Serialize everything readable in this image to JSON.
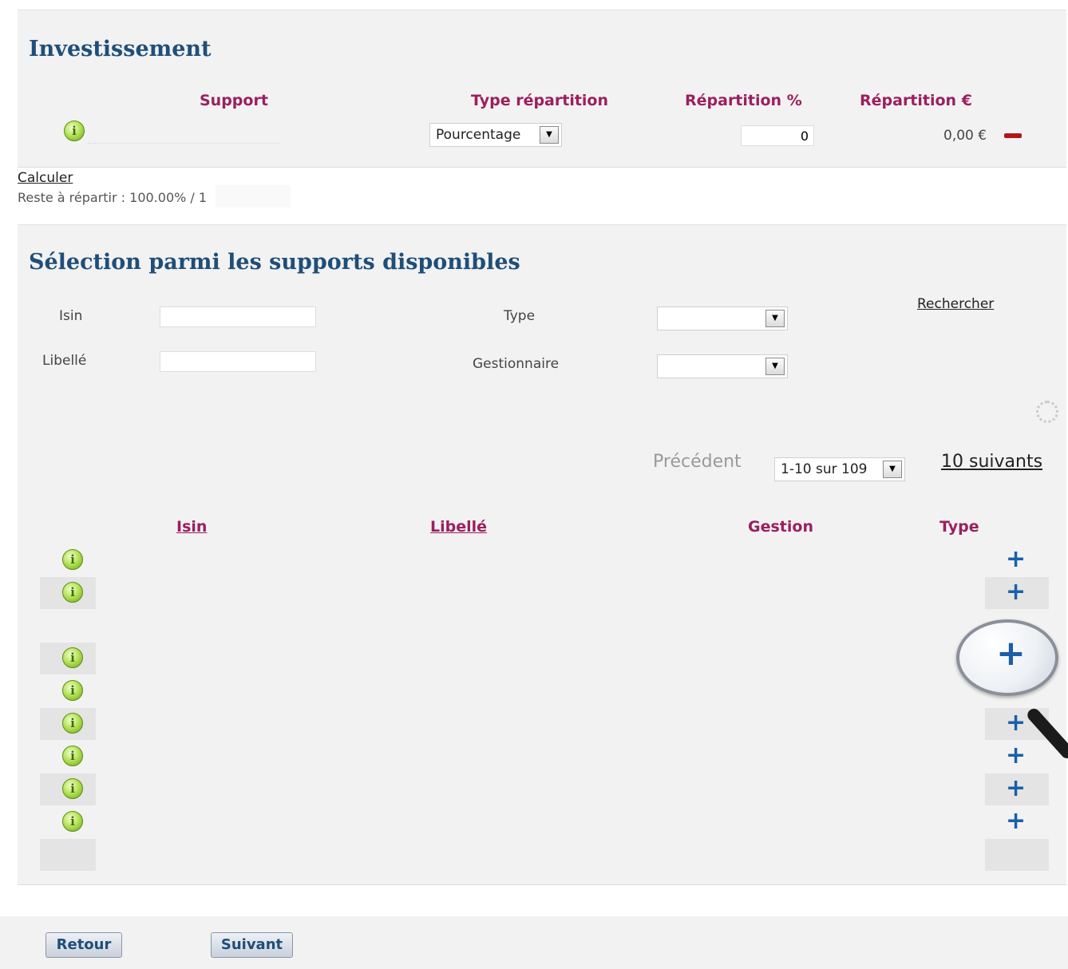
{
  "investissement": {
    "title": "Investissement",
    "headers": {
      "support": "Support",
      "type_repartition": "Type répartition",
      "repartition_pct": "Répartition %",
      "repartition_eur": "Répartition €"
    },
    "row": {
      "type_value": "Pourcentage",
      "pct_value": "0",
      "eur_value": "0,00 €"
    },
    "calculer_label": "Calculer",
    "reste_text": "Reste à répartir : 100.00% / 1"
  },
  "selection": {
    "title": "Sélection parmi les supports disponibles",
    "isin_label": "Isin",
    "libelle_label": "Libellé",
    "type_label": "Type",
    "gestionnaire_label": "Gestionnaire",
    "rechercher_label": "Rechercher",
    "precedent_label": "Précédent",
    "page_select_value": "1-10 sur 109",
    "suivants_label": "10 suivants",
    "table_headers": {
      "isin": "Isin",
      "libelle": "Libellé",
      "gestion": "Gestion",
      "type": "Type"
    }
  },
  "icons": {
    "info": "i",
    "plus": "+",
    "dropdown": "▼"
  },
  "footer": {
    "retour_label": "Retour",
    "suivant_label": "Suivant"
  },
  "colors": {
    "title_blue": "#1f4e79",
    "header_magenta": "#9b1f5e",
    "plus_blue": "#1a5fa8",
    "minus_red": "#b01818",
    "panel_bg": "#f2f2f2"
  }
}
